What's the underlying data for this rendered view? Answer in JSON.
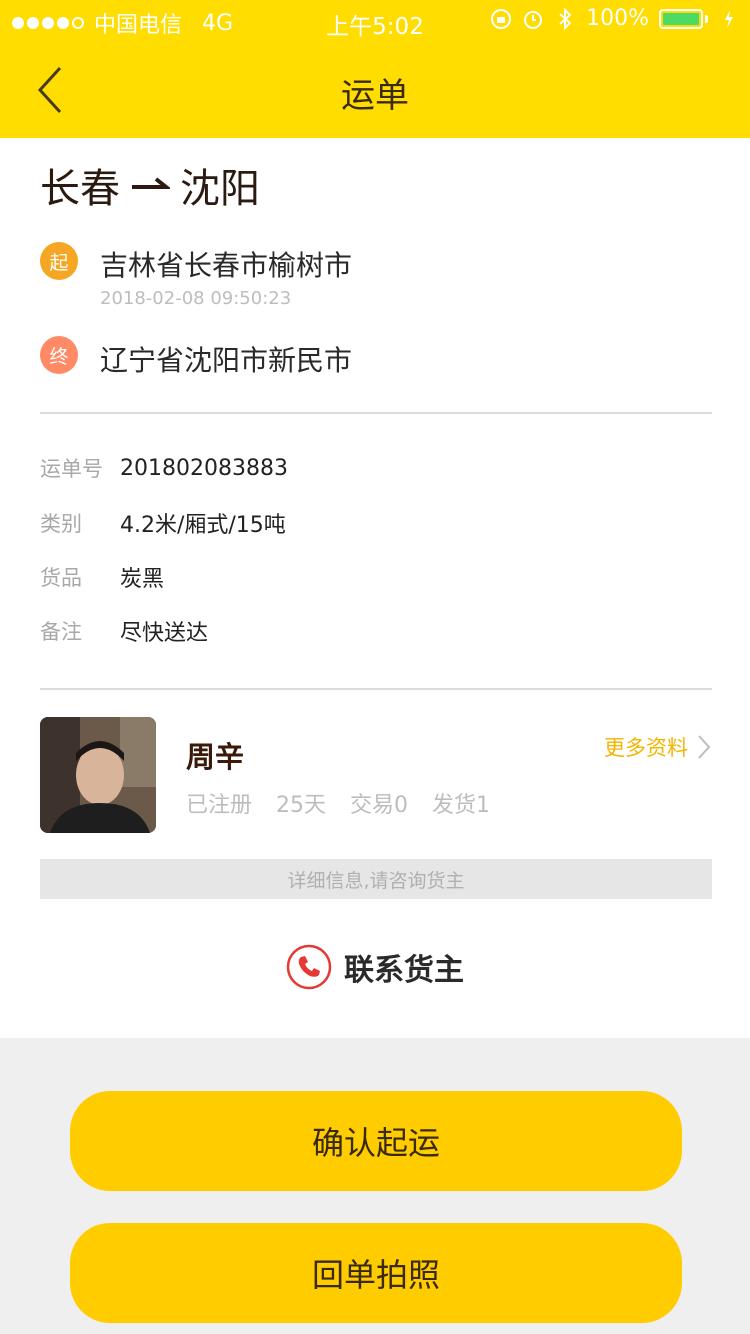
{
  "status_bar": {
    "carrier": "中国电信",
    "network": "4G",
    "time": "上午5:02",
    "battery": "100%"
  },
  "nav": {
    "title": "运单"
  },
  "route": {
    "from_city": "长春",
    "to_city": "沈阳",
    "start_badge": "起",
    "end_badge": "终",
    "start_place": "吉林省长春市榆树市",
    "start_time": "2018-02-08 09:50:23",
    "end_place": "辽宁省沈阳市新民市"
  },
  "details": [
    {
      "label": "运单号",
      "value": "201802083883"
    },
    {
      "label": "类别",
      "value": "4.2米/厢式/15吨"
    },
    {
      "label": "货品",
      "value": "炭黑"
    },
    {
      "label": "备注",
      "value": "尽快送达"
    }
  ],
  "owner": {
    "name": "周辛",
    "more_label": "更多资料",
    "stats": [
      "已注册",
      "25天",
      "交易0",
      "发货1"
    ]
  },
  "notice": "详细信息,请咨询货主",
  "contact_label": "联系货主",
  "buttons": {
    "confirm": "确认起运",
    "photo": "回单拍照"
  },
  "colors": {
    "header": "#ffdd00",
    "button": "#ffcc00",
    "start_badge": "#f5a623",
    "end_badge": "#ff8a65",
    "link": "#f5b400",
    "phone": "#e53935"
  }
}
